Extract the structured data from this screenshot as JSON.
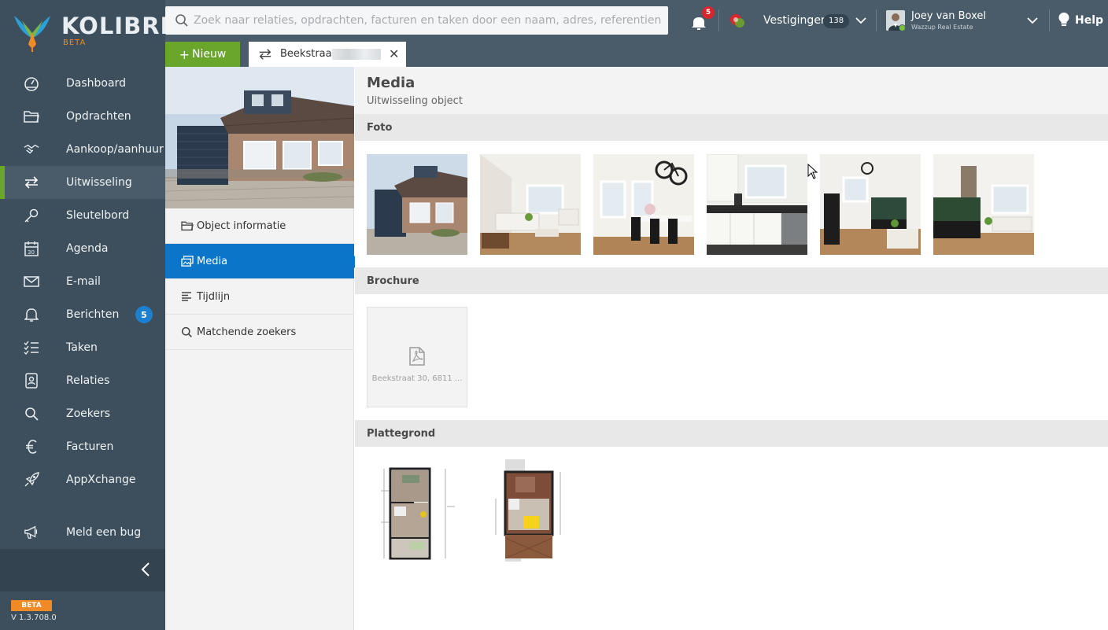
{
  "app": {
    "brand": "KOLIBRI",
    "brand_tag": "BETA",
    "version_badge": "BETA",
    "version": "V 1.3.708.0"
  },
  "sidebar": {
    "items": [
      {
        "label": "Dashboard",
        "icon": "dashboard-icon"
      },
      {
        "label": "Opdrachten",
        "icon": "folder-icon"
      },
      {
        "label": "Aankoop/aanhuur",
        "icon": "handshake-icon"
      },
      {
        "label": "Uitwisseling",
        "icon": "exchange-icon",
        "active": true
      },
      {
        "label": "Sleutelbord",
        "icon": "key-icon"
      },
      {
        "label": "Agenda",
        "icon": "calendar-icon"
      },
      {
        "label": "E-mail",
        "icon": "envelope-icon"
      },
      {
        "label": "Berichten",
        "icon": "bell-icon",
        "badge": "5"
      },
      {
        "label": "Taken",
        "icon": "tasks-icon"
      },
      {
        "label": "Relaties",
        "icon": "contact-card-icon"
      },
      {
        "label": "Zoekers",
        "icon": "search-icon"
      },
      {
        "label": "Facturen",
        "icon": "euro-icon"
      },
      {
        "label": "AppXchange",
        "icon": "rocket-icon"
      }
    ],
    "bug_report": "Meld een bug"
  },
  "topbar": {
    "search_placeholder": "Zoek naar relaties, opdrachten, facturen en taken door een naam, adres, referentienummer, o",
    "notification_count": "5",
    "vestigingen_label": "Vestigingen",
    "vestigingen_count": "138",
    "user_name": "Joey van Boxel",
    "user_org": "Wazzup Real Estate",
    "help_label": "Help"
  },
  "tabs": {
    "new_label": "Nieuw",
    "open_tab": "Beekstraat"
  },
  "subnav": {
    "items": [
      {
        "label": "Object informatie",
        "icon": "folder-icon"
      },
      {
        "label": "Media",
        "icon": "images-icon",
        "active": true
      },
      {
        "label": "Tijdlijn",
        "icon": "timeline-icon"
      },
      {
        "label": "Matchende zoekers",
        "icon": "search-icon"
      }
    ]
  },
  "main": {
    "title": "Media",
    "subtitle": "Uitwisseling object",
    "sections": {
      "foto": "Foto",
      "brochure": "Brochure",
      "plattegrond": "Plattegrond"
    },
    "photos": [
      "exterior",
      "living-room",
      "dining-room",
      "kitchen",
      "living-aquarium",
      "living-wide"
    ],
    "brochure_file": "Beekstraat 30, 6811 ..."
  },
  "colors": {
    "sidebar": "#3d4f5c",
    "topbar": "#4a5c69",
    "accent_green": "#6aa52c",
    "accent_blue": "#0a75c9",
    "brand_orange": "#f08a24",
    "badge_red": "#d9262c"
  }
}
